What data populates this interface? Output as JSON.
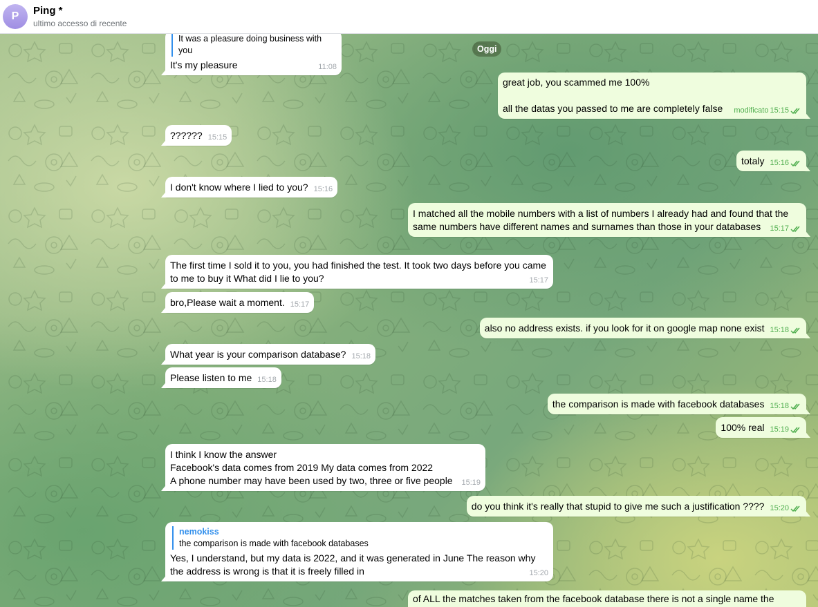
{
  "header": {
    "avatar_letter": "P",
    "title": "Ping *",
    "status": "ultimo accesso di recente"
  },
  "date_separator": "Oggi",
  "messages": [
    {
      "dir": "in",
      "reply_text": "It was a pleasure doing business with you",
      "text": "It's my pleasure",
      "time": "11:08"
    },
    {
      "dir": "out",
      "text": "great job, you scammed me 100%\n\nall the datas you passed to me are completely false",
      "edited": "modificato",
      "time": "15:15"
    },
    {
      "dir": "in",
      "text": "??????",
      "time": "15:15"
    },
    {
      "dir": "out",
      "text": "totaly",
      "time": "15:16"
    },
    {
      "dir": "in",
      "text": "I don't know where I lied to you?",
      "time": "15:16"
    },
    {
      "dir": "out",
      "text": "I matched all the mobile numbers with a list of numbers I already had and found that the same numbers have different names and surnames than those in your databases",
      "time": "15:17"
    },
    {
      "dir": "in",
      "text": "The first time I sold it to you, you had finished the test. It took two days before you came to me to buy it What did I lie to you?",
      "time": "15:17"
    },
    {
      "dir": "in",
      "text": "bro,Please wait a moment.",
      "time": "15:17"
    },
    {
      "dir": "out",
      "text": "also no address exists. if you look for it on google map none exist",
      "time": "15:18"
    },
    {
      "dir": "in",
      "text": "What year is your comparison database?",
      "time": "15:18"
    },
    {
      "dir": "in",
      "text": "Please listen to me",
      "time": "15:18"
    },
    {
      "dir": "out",
      "text": "the comparison is made with facebook databases",
      "time": "15:18"
    },
    {
      "dir": "out",
      "text": "100% real",
      "time": "15:19"
    },
    {
      "dir": "in",
      "text": "I think I know the answer\nFacebook's data comes from 2019 My data comes from 2022\nA phone number may have been used by two, three or five people",
      "time": "15:19"
    },
    {
      "dir": "out",
      "text": "do you think it's really that stupid to give me such a justification ????",
      "time": "15:20"
    },
    {
      "dir": "in",
      "reply_name": "nemokiss",
      "reply_text": "the comparison is made with facebook databases",
      "text": "Yes, I understand, but my data is 2022, and it was generated in June The reason why the address is wrong is that it is freely filled in",
      "time": "15:20"
    },
    {
      "dir": "out",
      "text": "of ALL the matches taken from the facebook database there is not a single name the"
    }
  ],
  "colors": {
    "incoming": "#ffffff",
    "outgoing": "#effdde",
    "time_out": "#4fae4e",
    "accent": "#3390ec"
  },
  "icons": {
    "read_receipt": "double-check-icon"
  }
}
